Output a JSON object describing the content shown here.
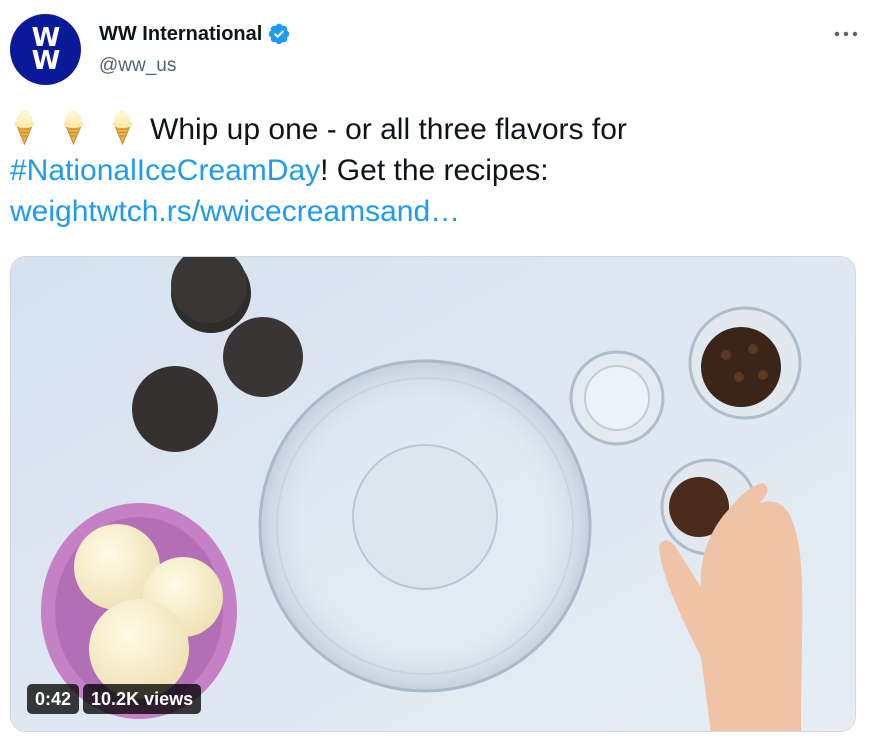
{
  "tweet": {
    "author": {
      "display_name": "WW International",
      "handle": "@ww_us",
      "avatar_text": "WW",
      "verified": true
    },
    "text": {
      "emojis": [
        "ice-cream-cone",
        "ice-cream-cone",
        "ice-cream-cone"
      ],
      "line1": "Whip up one - or all three flavors for",
      "hashtag": "#NationalIceCreamDay",
      "after_hashtag": "! Get the recipes:",
      "link": "weightwtch.rs/wwicecreamsand…"
    },
    "video": {
      "duration": "0:42",
      "views": "10.2K views"
    }
  },
  "colors": {
    "accent": "#1d9bf0",
    "avatar_bg": "#0a1a9a",
    "handle": "#536471"
  }
}
